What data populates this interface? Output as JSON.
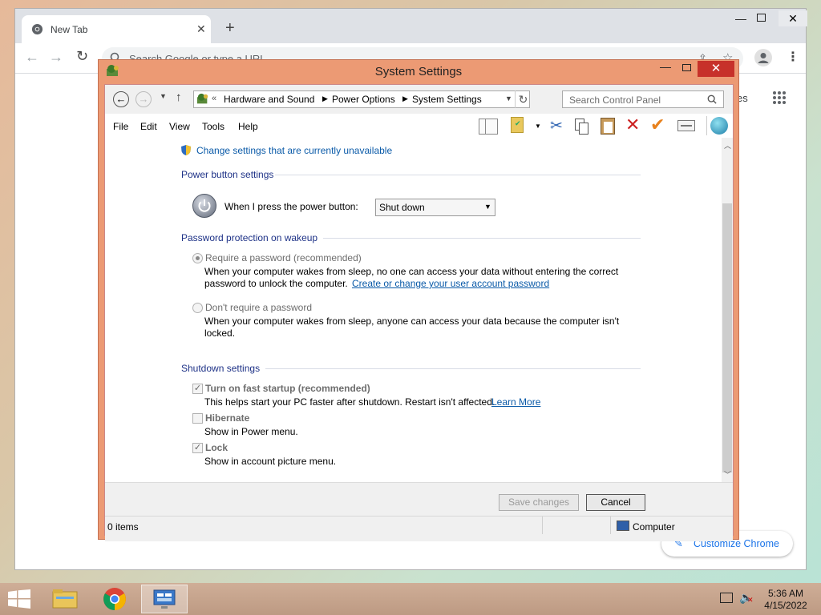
{
  "colors": {
    "window_frame": "#ec9a74",
    "close_button": "#c7312a",
    "link": "#0a5aa8",
    "section_title": "#1e3287",
    "chrome_accent": "#1a73e8"
  },
  "chrome": {
    "tab_title": "New Tab",
    "omnibox_placeholder": "Search Google or type a URL",
    "side_text": "es",
    "customize_label": "Customize Chrome"
  },
  "window": {
    "title": "System Settings",
    "breadcrumb": {
      "root": "Hardware and Sound",
      "parent": "Power Options",
      "current": "System Settings"
    },
    "search_placeholder": "Search Control Panel",
    "menu": [
      "File",
      "Edit",
      "View",
      "Tools",
      "Help"
    ],
    "admin_link": "Change settings that are currently unavailable",
    "power_section": {
      "title": "Power button settings",
      "label": "When I press the power button:",
      "selected": "Shut down"
    },
    "password_section": {
      "title": "Password protection on wakeup",
      "require_label": "Require a password (recommended)",
      "require_desc_1": "When your computer wakes from sleep, no one can access your data without entering the correct",
      "require_desc_2": "password to unlock the computer.",
      "require_link": "Create or change your user account password",
      "norequire_label": "Don't require a password",
      "norequire_desc_1": "When your computer wakes from sleep, anyone can access your data because the computer isn't",
      "norequire_desc_2": "locked."
    },
    "shutdown_section": {
      "title": "Shutdown settings",
      "fast_label": "Turn on fast startup (recommended)",
      "fast_desc": "This helps start your PC faster after shutdown. Restart isn't affected.",
      "fast_link": "Learn More",
      "fast_checked": true,
      "hibernate_label": "Hibernate",
      "hibernate_desc": "Show in Power menu.",
      "hibernate_checked": false,
      "lock_label": "Lock",
      "lock_desc": "Show in account picture menu.",
      "lock_checked": true
    },
    "buttons": {
      "save": "Save changes",
      "cancel": "Cancel"
    },
    "status": {
      "items": "0 items",
      "location": "Computer"
    }
  },
  "taskbar": {
    "time": "5:36 AM",
    "date": "4/15/2022"
  }
}
